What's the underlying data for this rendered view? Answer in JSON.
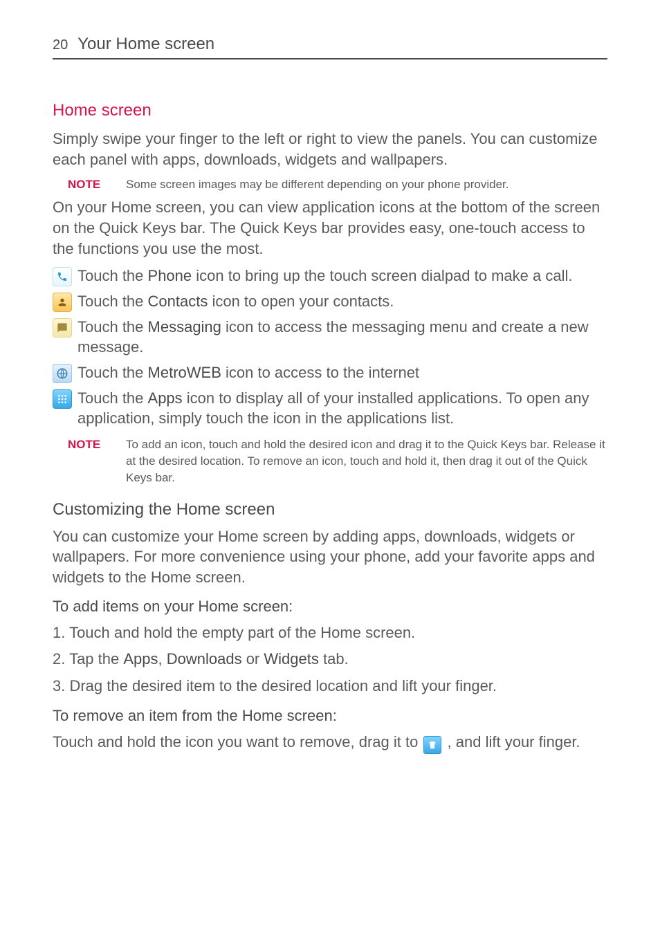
{
  "header": {
    "page_number": "20",
    "title": "Your Home screen"
  },
  "section": {
    "title": "Home screen",
    "intro": "Simply swipe your finger to the left or right to view the panels. You can customize each panel with apps, downloads, widgets and wallpapers.",
    "note1_label": "NOTE",
    "note1_body": "Some screen images may be different depending on your phone provider.",
    "quickkeys_intro": "On your Home screen, you can view application icons at the bottom of the screen on the Quick Keys bar. The Quick Keys bar provides easy, one-touch access to the functions you use the most."
  },
  "icons": {
    "phone_pre": "Touch the ",
    "phone_bold": "Phone",
    "phone_post": " icon to bring up the touch screen dialpad to make a call.",
    "contacts_pre": "Touch the ",
    "contacts_bold": "Contacts",
    "contacts_post": " icon to open your contacts.",
    "messaging_pre": "Touch the ",
    "messaging_bold": "Messaging",
    "messaging_post": " icon to access the messaging menu and create a new message.",
    "web_pre": "Touch the ",
    "web_bold": "MetroWEB",
    "web_post": " icon to access to the internet",
    "apps_pre": "Touch the ",
    "apps_bold": "Apps",
    "apps_post": " icon to display all of your installed applications. To open any application, simply touch the icon in the applications list."
  },
  "note2": {
    "label": "NOTE",
    "body": "To add an icon, touch and hold the desired icon and drag it to the Quick Keys bar. Release it at the desired location. To remove an icon, touch and hold it, then drag it out of the Quick Keys bar."
  },
  "customize": {
    "heading": "Customizing the Home screen",
    "intro": "You can customize your Home screen by adding apps, downloads, widgets or wallpapers. For more convenience using your phone, add your favorite apps and widgets to the Home screen.",
    "add_heading": "To add items on your Home screen:",
    "step1": "1.  Touch and hold the empty part of the Home screen.",
    "step2_pre": "2. Tap the ",
    "step2_b1": "Apps",
    "step2_mid1": ", ",
    "step2_b2": "Downloads",
    "step2_mid2": " or ",
    "step2_b3": "Widgets",
    "step2_post": " tab.",
    "step3": "3. Drag the desired item to the desired location and lift your finger.",
    "remove_heading": "To remove an item from the Home screen:",
    "remove_pre": "Touch and hold the icon you want to remove, drag it to ",
    "remove_post": " , and lift your finger."
  }
}
